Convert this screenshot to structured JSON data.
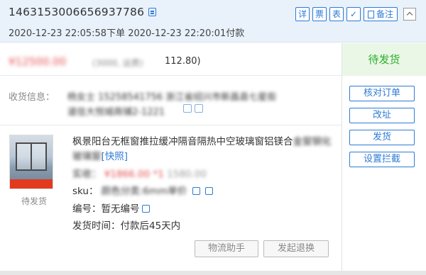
{
  "header": {
    "order_id": "1463153006656937786",
    "times": "2020-12-23 22:05:58下单 2020-12-23 22:20:01付款",
    "buttons": {
      "detail": "详",
      "invoice": "票",
      "table": "表",
      "note": "备注"
    }
  },
  "price": {
    "amount": "¥12500.00",
    "sub": "(3000, 运费)",
    "tail": "112.80)"
  },
  "status": "待发货",
  "actions": [
    "核对订单",
    "改址",
    "发货",
    "设置拦截"
  ],
  "address": {
    "label": "收货信息：",
    "line1": "杨女士 15258541756 浙江省绍兴市新昌县七星街",
    "line2": "道信大悦城商铺2-1221"
  },
  "item": {
    "status": "待发货",
    "title_visible": "枫景阳台无框窗推拉缓冲隔音隔热中空玻璃窗铝镁合",
    "title_blurred": "金窗钢化玻璃窗",
    "title_flash": "[快照]",
    "price_label": "实收：",
    "price_value": "¥1866.00 *1",
    "price_orig": "1580.00",
    "sku_label": "sku：",
    "sku_value": "颜色分类:6mm单价",
    "code_label": "编号：",
    "code_value": "暂无编号",
    "ship_label": "发货时间：",
    "ship_value": "付款后45天内"
  },
  "bottom_buttons": [
    "物流助手",
    "发起退换"
  ]
}
